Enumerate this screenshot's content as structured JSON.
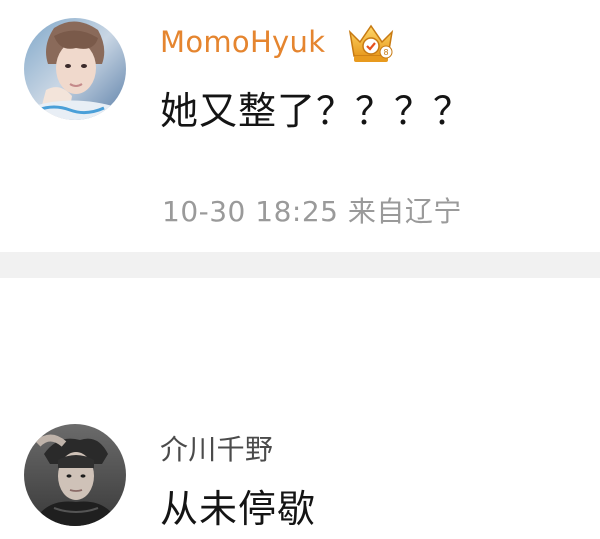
{
  "comments": [
    {
      "username": "MomoHyuk",
      "badge_icon": "vip-crown-badge-icon",
      "text": "她又整了？？？？",
      "timestamp": "10-30 18:25",
      "location": "来自辽宁",
      "username_color": "#e5852f"
    },
    {
      "username": "介川千野",
      "text": "从未停歇",
      "username_color": "#4b4b4b"
    }
  ],
  "colors": {
    "background": "#ffffff",
    "divider": "#f1f1f1",
    "meta_text": "#9a9a9a",
    "body_text": "#141414"
  }
}
